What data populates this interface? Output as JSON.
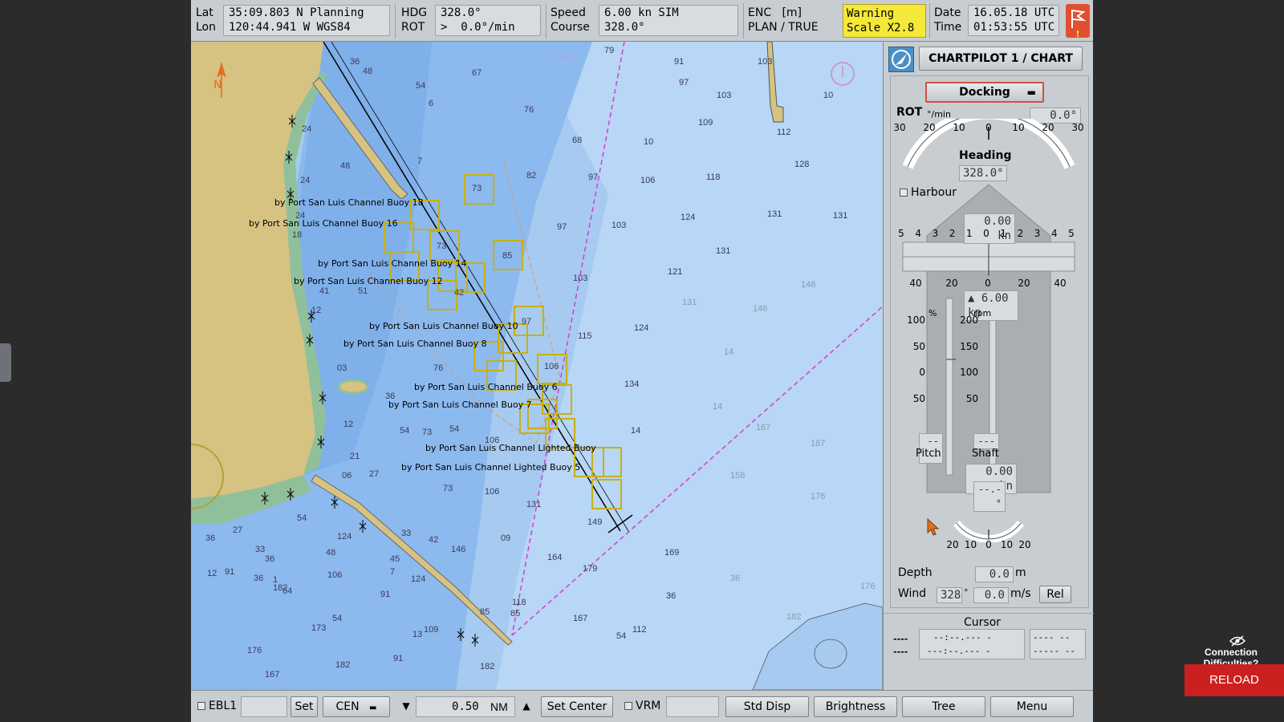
{
  "topbar": {
    "lat_label": "Lat",
    "lon_label": "Lon",
    "lat_value": "35:09.803 N Planning",
    "lon_value": "120:44.941 W WGS84",
    "hdg_label": "HDG",
    "rot_label": "ROT",
    "hdg_value": "328.0°",
    "rot_value": ">  0.0°/min",
    "speed_label": "Speed",
    "course_label": "Course",
    "speed_value": "6.00 kn SIM",
    "course_value": "328.0°",
    "enc_label": "ENC   [m]",
    "plan_label": "PLAN / TRUE",
    "warning_line1": "Warning",
    "warning_line2": "Scale X2.8",
    "date_label": "Date",
    "time_label": "Time",
    "date_value": "16.05.18 UTC",
    "time_value": "01:53:55 UTC"
  },
  "chart": {
    "depths": [
      "36",
      "48",
      "54",
      "67",
      "79",
      "91",
      "103",
      "6",
      "76",
      "97",
      "103",
      "10",
      "24",
      "7",
      "68",
      "10",
      "109",
      "112",
      "24",
      "48",
      "82",
      "97",
      "106",
      "118",
      "128",
      "73",
      "124",
      "103",
      "131",
      "131",
      "97",
      "85",
      "121",
      "131",
      "24",
      "18",
      "41",
      "73",
      "103",
      "146",
      "42",
      "51",
      "115",
      "124",
      "131",
      "146",
      "97",
      "12",
      "03",
      "106",
      "76",
      "134",
      "14",
      "14",
      "14",
      "36",
      "12",
      "54",
      "73",
      "54",
      "106",
      "167",
      "167",
      "158",
      "21",
      "06",
      "27",
      "73",
      "106",
      "131",
      "176",
      "36",
      "27",
      "33",
      "36",
      "54",
      "48",
      "124",
      "09",
      "33",
      "42",
      "146",
      "149",
      "164",
      "179",
      "169",
      "36",
      "36",
      "54",
      "12",
      "91",
      "36",
      "1",
      "64",
      "45",
      "7",
      "124",
      "182",
      "106",
      "91",
      "54",
      "13",
      "85",
      "118",
      "112",
      "85",
      "109",
      "91",
      "173",
      "176",
      "182",
      "167",
      "182",
      "167",
      "176",
      "182"
    ],
    "buoys": [
      "by Port San Luis Channel Buoy 18",
      "by Port San Luis Channel Buoy 16",
      "by Port San Luis Channel Buoy 14",
      "by Port San Luis Channel Buoy 12",
      "by Port San Luis Channel Buoy 10",
      "by Port San Luis Channel Buoy 8",
      "by Port San Luis Channel Buoy 6",
      "by Port San Luis Channel Buoy 7",
      "by Port San Luis Channel Lighted Buoy",
      "by Port San Luis Channel Lighted Buoy 5"
    ]
  },
  "panel": {
    "title": "CHARTPILOT 1 / CHART",
    "mode": "Docking",
    "rot_label": "ROT",
    "rot_unit": "°/min",
    "rot_value": "0.0°",
    "rot_scale": [
      "30",
      "20",
      "10",
      "0",
      "10",
      "20",
      "30"
    ],
    "heading_label": "Heading",
    "heading_value": "328.0°",
    "harbour_label": "Harbour",
    "lateral_speed": "0.00 kn",
    "lateral_scale": [
      "5",
      "4",
      "3",
      "2",
      "1",
      "0",
      "1",
      "2",
      "3",
      "4",
      "5"
    ],
    "lower_scale": [
      "40",
      "20",
      "0",
      "20",
      "40"
    ],
    "speed_value": "▲ 6.00 kn",
    "pitch_unit": "%",
    "rpm_unit": "rpm",
    "pitch_scale": [
      "100",
      "50",
      "0",
      "50"
    ],
    "rpm_scale": [
      "200",
      "150",
      "100",
      "50"
    ],
    "pitch_value": "---",
    "shaft_value": "---",
    "pitch_label": "Pitch",
    "shaft_label": "Shaft",
    "aft_speed": "0.00 kn",
    "rudder_value": "--.-°",
    "rudder_scale": [
      "20",
      "10",
      "0",
      "10",
      "20"
    ],
    "depth_label": "Depth",
    "depth_value": "0.0",
    "depth_unit": "m",
    "wind_label": "Wind",
    "wind_dir": "328",
    "wind_dir_unit": "°",
    "wind_speed": "0.0",
    "wind_unit": "m/s",
    "wind_ref": "Rel",
    "cursor_label": "Cursor",
    "cursor_dash1": "----",
    "cursor_dash2": "----",
    "cursor_pos1": "--:--.--- -",
    "cursor_pos2": "---:--.--- -",
    "cursor_r1": "---- --",
    "cursor_r2": "----- --"
  },
  "bottombar": {
    "ebl_label": "EBL1",
    "set_label": "Set",
    "cen_label": "CEN",
    "range_value": "0.50",
    "range_unit": "NM",
    "set_center_label": "Set Center",
    "vrm_label": "VRM",
    "std_disp_label": "Std Disp",
    "brightness_label": "Brightness",
    "tree_label": "Tree",
    "menu_label": "Menu"
  },
  "overlay": {
    "connection_text": "Connection Difficulties?",
    "reload_label": "RELOAD"
  },
  "colors": {
    "deep_water": "#a6caf0",
    "shallow_water": "#7fb0ea",
    "land": "#d6c382",
    "intertidal": "#8fc09a",
    "warning": "#f4e838",
    "route_magenta": "#d23fd2",
    "reload_red": "#cc1f1f"
  }
}
